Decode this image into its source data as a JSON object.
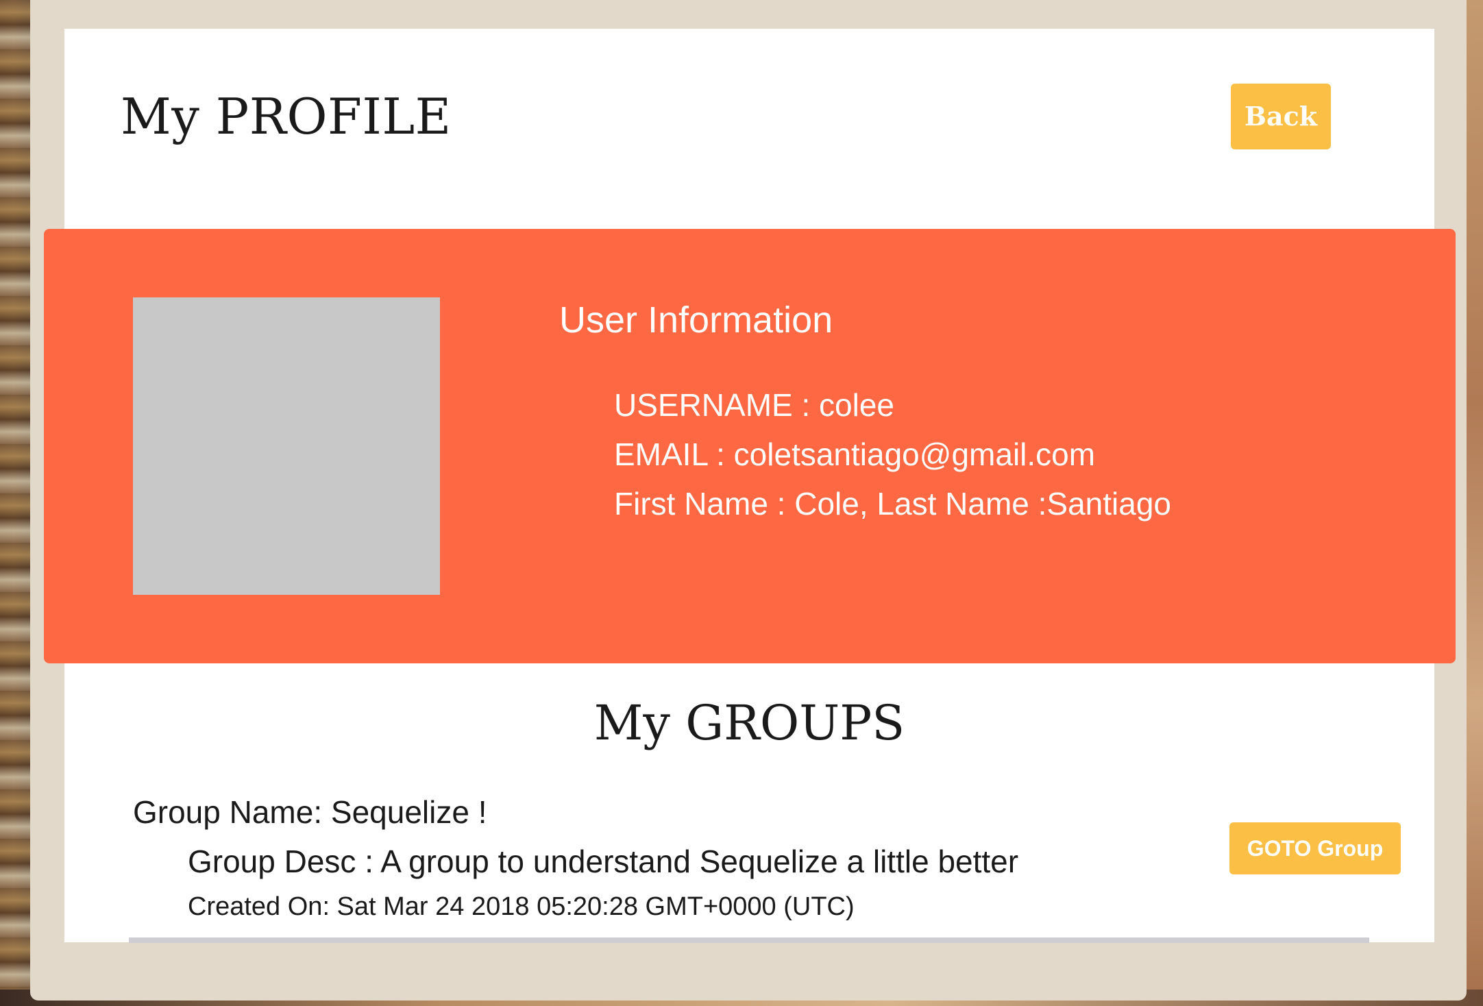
{
  "header": {
    "title": "My PROFILE",
    "back_label": "Back"
  },
  "user_info": {
    "heading": "User Information",
    "username_line": "USERNAME : colee",
    "email_line": "EMAIL : coletsantiago@gmail.com",
    "name_line": "First Name : Cole, Last Name :Santiago"
  },
  "groups": {
    "title": "My GROUPS",
    "items": [
      {
        "name_line": "Group Name: Sequelize !",
        "desc_line": "Group Desc : A group to understand Sequelize a little better",
        "created_line": "Created On: Sat Mar 24 2018 05:20:28 GMT+0000 (UTC)",
        "goto_label": "GOTO Group"
      }
    ]
  },
  "colors": {
    "accent_orange": "#fe6842",
    "button_yellow": "#fbbf45",
    "frame_beige": "#e2d9ca",
    "avatar_placeholder": "#c8c8c8"
  }
}
